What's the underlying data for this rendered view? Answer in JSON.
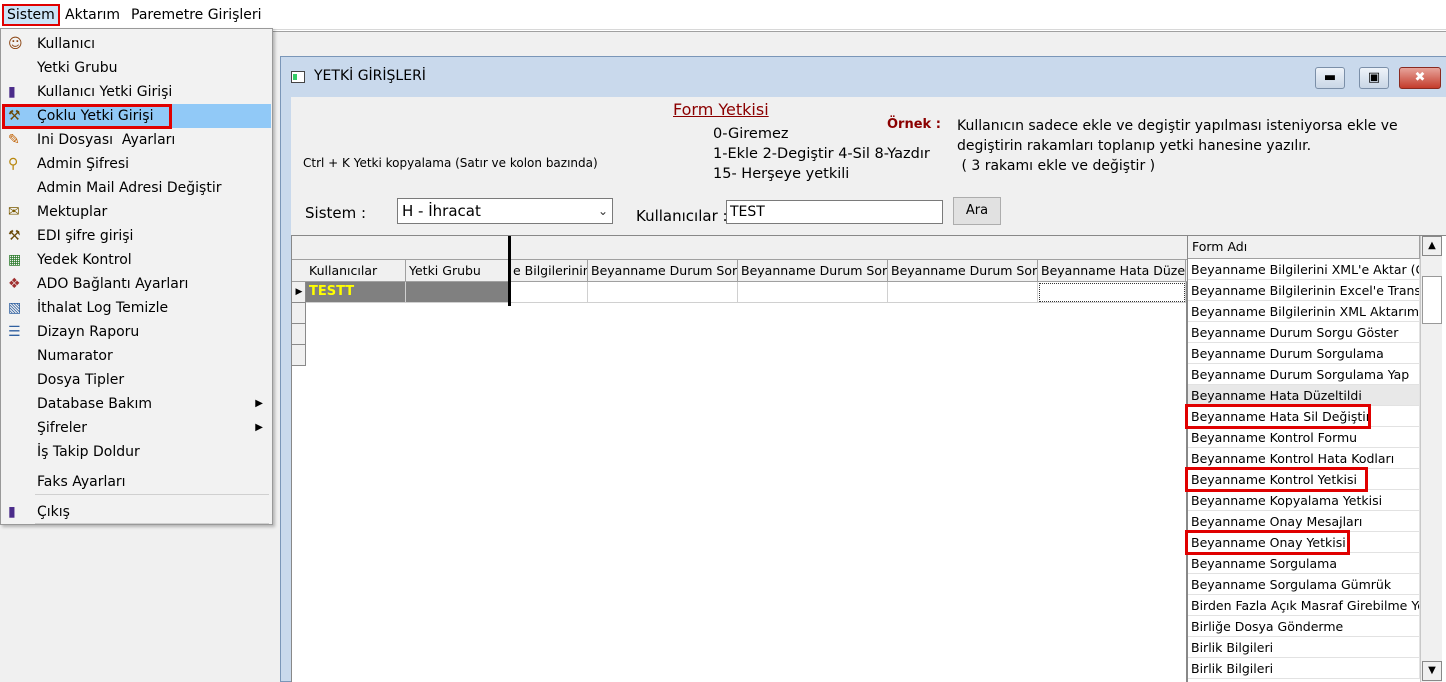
{
  "menubar": {
    "items": [
      "Sistem",
      "Aktarım",
      "Paremetre Girişleri"
    ]
  },
  "dropdown": {
    "items": [
      {
        "label": "Kullanıcı",
        "icon": "user-icon"
      },
      {
        "label": "Yetki Grubu",
        "icon": ""
      },
      {
        "label": "Kullanıcı Yetki Girişi",
        "icon": "user-permission-icon"
      },
      {
        "label": "Çoklu Yetki Girişi",
        "icon": "multi-permission-icon"
      },
      {
        "label": "Ini Dosyası  Ayarları",
        "icon": "ini-file-icon"
      },
      {
        "label": "Admin Şifresi",
        "icon": "key-icon"
      },
      {
        "label": "Admin Mail Adresi Değiştir",
        "icon": ""
      },
      {
        "label": "Mektuplar",
        "icon": "letters-icon"
      },
      {
        "label": "EDI şifre girişi",
        "icon": "edi-password-icon"
      },
      {
        "label": "Yedek Kontrol",
        "icon": "backup-icon"
      },
      {
        "label": "ADO Bağlantı Ayarları",
        "icon": "connection-icon"
      },
      {
        "label": "İthalat Log Temizle",
        "icon": "log-clean-icon"
      },
      {
        "label": "Dizayn Raporu",
        "icon": "design-report-icon"
      },
      {
        "label": "Numarator",
        "icon": ""
      },
      {
        "label": "Dosya Tipler",
        "icon": ""
      },
      {
        "label": "Database Bakım",
        "icon": ""
      },
      {
        "label": "Şifreler",
        "icon": ""
      },
      {
        "label": "İş Takip Doldur",
        "icon": ""
      },
      {
        "label": "Faks Ayarları",
        "icon": ""
      },
      {
        "label": "Çıkış",
        "icon": "exit-icon"
      }
    ]
  },
  "window": {
    "title": "YETKİ GİRİŞLERİ",
    "form_title": "Form Yetkisi",
    "copy_hint": "Ctrl + K Yetki kopyalama (Satır ve kolon bazında)",
    "legend": [
      "0-Giremez",
      "1-Ekle  2-Degiştir  4-Sil  8-Yazdır",
      "15- Herşeye yetkili"
    ],
    "ornek_label": "Örnek :",
    "ornek_text": [
      "Kullanıcın sadece ekle ve degiştir yapılması isteniyorsa  ekle ve",
      "degiştirin rakamları toplanıp yetki hanesine yazılır.",
      " ( 3 rakamı ekle ve değiştir )"
    ],
    "sistem_label": "Sistem :",
    "sistem_value": "H - İhracat",
    "kullanicilar_label": "Kullanıcılar :",
    "kullanicilar_value": "TEST",
    "ara_label": "Ara"
  },
  "grid": {
    "columns": [
      "Kullanıcılar",
      "Yetki Grubu",
      "e Bilgilerinin X",
      "Beyanname Durum Sorg",
      "Beyanname Durum Sorg",
      "Beyanname Durum Sorg",
      "Beyanname Hata Düzelt"
    ],
    "row": [
      "TESTT",
      "",
      "",
      "",
      "",
      "",
      ""
    ]
  },
  "form_list": {
    "header": "Form Adı",
    "items": [
      "Beyanname Bilgilerini XML'e Aktar (GE",
      "Beyanname Bilgilerinin Excel'e Transfe",
      "Beyanname Bilgilerinin XML Aktarımı (K",
      "Beyanname Durum Sorgu Göster",
      "Beyanname Durum Sorgulama",
      "Beyanname Durum Sorgulama Yap",
      "Beyanname Hata Düzeltildi",
      "Beyanname Hata Sil Değiştir",
      "Beyanname Kontrol Formu",
      "Beyanname Kontrol Hata Kodları",
      "Beyanname Kontrol Yetkisi",
      "Beyanname Kopyalama Yetkisi",
      "Beyanname Onay Mesajları",
      "Beyanname Onay Yetkisi",
      "Beyanname Sorgulama",
      "Beyanname Sorgulama Gümrük",
      "Birden Fazla Açık Masraf Girebilme Ye",
      "Birliğe Dosya Gönderme",
      "Birlik Bilgileri",
      "Birlik Bilgileri"
    ]
  },
  "colors": {
    "highlight_border": "#e00000",
    "menu_selected": "#91c9f7",
    "accent_text": "#8b0000",
    "yellow_text": "#ffff00"
  }
}
